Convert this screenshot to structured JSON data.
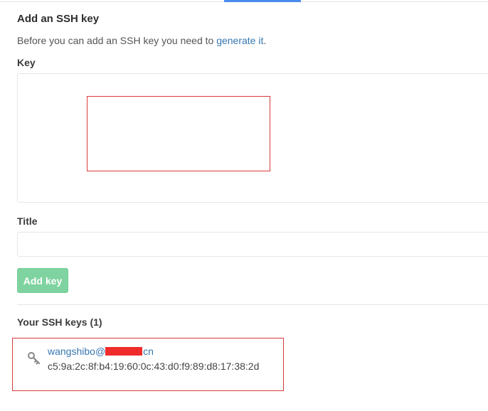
{
  "form": {
    "heading": "Add an SSH key",
    "intro_text": "Before you can add an SSH key you need to ",
    "intro_link": "generate it",
    "intro_suffix": ".",
    "key_label": "Key",
    "key_value": "",
    "title_label": "Title",
    "title_value": "",
    "add_button_label": "Add key"
  },
  "keys": {
    "heading": "Your SSH keys (1)",
    "items": [
      {
        "name_prefix": "wangshibo@",
        "name_suffix": "cn",
        "fingerprint": "c5:9a:2c:8f:b4:19:60:0c:43:d0:f9:89:d8:17:38:2d"
      }
    ]
  },
  "colors": {
    "accent_tab": "#4a8bee",
    "link": "#3777b0",
    "button_green": "#7fd3a0",
    "annotation_red": "#d93b3b"
  },
  "icons": {
    "key_item": "key-icon"
  }
}
